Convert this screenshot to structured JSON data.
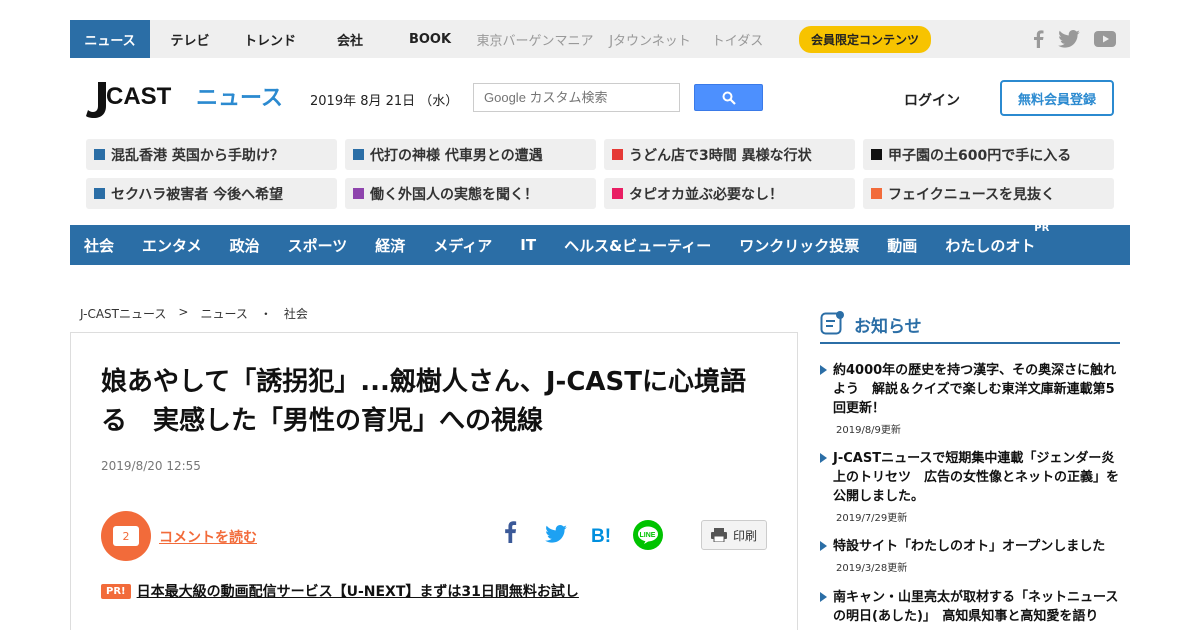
{
  "topnav": {
    "tabs": [
      {
        "label": "ニュース"
      },
      {
        "label": "テレビ"
      },
      {
        "label": "トレンド"
      },
      {
        "label": "会社"
      },
      {
        "label": "BOOK"
      },
      {
        "label": "東京バーゲンマニア"
      },
      {
        "label": "Jタウンネット"
      },
      {
        "label": "トイダス"
      }
    ],
    "member_label": "会員限定コンテンツ",
    "social": [
      "facebook-icon",
      "twitter-icon",
      "youtube-icon"
    ]
  },
  "header": {
    "logo": "J-CAST ニュース",
    "date": "2019年 8月 21日 （水）",
    "search_placeholder": "Google カスタム検索",
    "login": "ログイン",
    "register": "無料会員登録"
  },
  "topics": [
    {
      "label": "混乱香港 英国から手助け？",
      "color": "#2b6ea6"
    },
    {
      "label": "代打の神様 代車男との遭遇",
      "color": "#2b6ea6"
    },
    {
      "label": "うどん店で3時間 異様な行状",
      "color": "#e53935"
    },
    {
      "label": "甲子園の土600円で手に入る",
      "color": "#111111"
    },
    {
      "label": "セクハラ被害者 今後へ希望",
      "color": "#2b6ea6"
    },
    {
      "label": "働く外国人の実態を聞く！",
      "color": "#8e44ad"
    },
    {
      "label": "タピオカ並ぶ必要なし！",
      "color": "#e91e63"
    },
    {
      "label": "フェイクニュースを見抜く",
      "color": "#f26b3a"
    }
  ],
  "mainnav": {
    "items": [
      "社会",
      "エンタメ",
      "政治",
      "スポーツ",
      "経済",
      "メディア",
      "IT",
      "ヘルス&ビューティー",
      "ワンクリック投票",
      "動画",
      "わたしのオト"
    ],
    "pr": "PR"
  },
  "breadcrumb": [
    "J-CASTニュース",
    ">",
    "ニュース",
    "・",
    "社会"
  ],
  "article": {
    "headline": "娘あやして「誘拐犯」...劔樹人さん、J-CASTに心境語る　実感した「男性の育児」への視線",
    "date": "2019/8/20 12:55",
    "comment_count": "2",
    "comment_link": "コメントを読む",
    "print": "印刷",
    "pr_badge": "PR!",
    "pr_text": "日本最大級の動画配信サービス【U-NEXT】まずは31日間無料お試し"
  },
  "sidebar": {
    "title": "お知らせ",
    "items": [
      {
        "text": "約4000年の歴史を持つ漢字、その奥深さに触れよう　解説＆クイズで楽しむ東洋文庫新連載第5回更新！",
        "date": "2019/8/9更新"
      },
      {
        "text": "J-CASTニュースで短期集中連載「ジェンダー炎上のトリセツ　広告の女性像とネットの正義」を公開しました。",
        "date": "2019/7/29更新"
      },
      {
        "text": "特設サイト「わたしのオト」オープンしました",
        "date": "2019/3/28更新"
      },
      {
        "text": "南キャン・山里亮太が取材する「ネットニュースの明日(あした)」　高知県知事と高知愛を語り",
        "date": ""
      }
    ]
  },
  "colors": {
    "brand": "#2b6ea6",
    "accent": "#f26b3a",
    "member": "#f7c300"
  }
}
